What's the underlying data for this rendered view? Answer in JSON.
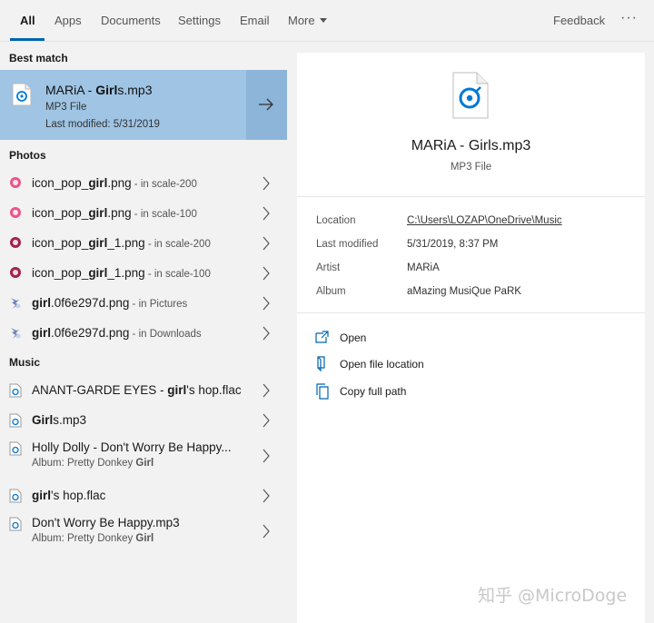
{
  "tabs": [
    {
      "label": "All",
      "active": true
    },
    {
      "label": "Apps"
    },
    {
      "label": "Documents"
    },
    {
      "label": "Settings"
    },
    {
      "label": "Email"
    },
    {
      "label": "More"
    }
  ],
  "feedback_label": "Feedback",
  "more_options_label": "···",
  "sections": {
    "best_match": "Best match",
    "photos": "Photos",
    "music": "Music"
  },
  "best_match": {
    "title_pre": "MARiA - ",
    "title_bold": "Girl",
    "title_post": "s.mp3",
    "type": "MP3 File",
    "modified": "Last modified: 5/31/2019"
  },
  "photos": [
    {
      "pre": "icon_pop_",
      "bold": "girl",
      "post": ".png",
      "loc": " - in scale-200",
      "color": "#e9558a"
    },
    {
      "pre": "icon_pop_",
      "bold": "girl",
      "post": ".png",
      "loc": " - in scale-100",
      "color": "#e9558a"
    },
    {
      "pre": "icon_pop_",
      "bold": "girl",
      "post": "_1.png",
      "loc": " - in scale-200",
      "color": "#a3204f"
    },
    {
      "pre": "icon_pop_",
      "bold": "girl",
      "post": "_1.png",
      "loc": " - in scale-100",
      "color": "#a3204f"
    },
    {
      "pre": "",
      "bold": "girl",
      "post": ".0f6e297d.png",
      "loc": " - in Pictures"
    },
    {
      "pre": "",
      "bold": "girl",
      "post": ".0f6e297d.png",
      "loc": " - in Downloads"
    }
  ],
  "music": [
    {
      "pre": "ANANT-GARDE EYES - ",
      "bold": "girl",
      "post": "'s hop.flac"
    },
    {
      "pre": "",
      "bold": "Girl",
      "post": "s.mp3"
    },
    {
      "pre": "Holly Dolly - Don't Worry Be Happy...",
      "bold": "",
      "post": "",
      "sub_pre": "Album: Pretty Donkey ",
      "sub_bold": "Girl"
    },
    {
      "pre": "",
      "bold": "girl",
      "post": "'s hop.flac"
    },
    {
      "pre": "Don't Worry Be Happy.mp3",
      "bold": "",
      "post": "",
      "sub_pre": "Album: Pretty Donkey ",
      "sub_bold": "Girl"
    }
  ],
  "preview": {
    "title": "MARiA - Girls.mp3",
    "type": "MP3 File",
    "properties": [
      {
        "key": "Location",
        "value": "C:\\Users\\LOZAP\\OneDrive\\Music"
      },
      {
        "key": "Last modified",
        "value": "5/31/2019, 8:37 PM"
      },
      {
        "key": "Artist",
        "value": "MARiA"
      },
      {
        "key": "Album",
        "value": "aMazing MusiQue PaRK"
      }
    ],
    "actions": [
      "Open",
      "Open file location",
      "Copy full path"
    ]
  },
  "watermark": "知乎 @MicroDoge",
  "colors": {
    "accent": "#0063b1",
    "selected": "#9fc4e4",
    "selected_arrow": "#8cb5d9"
  }
}
